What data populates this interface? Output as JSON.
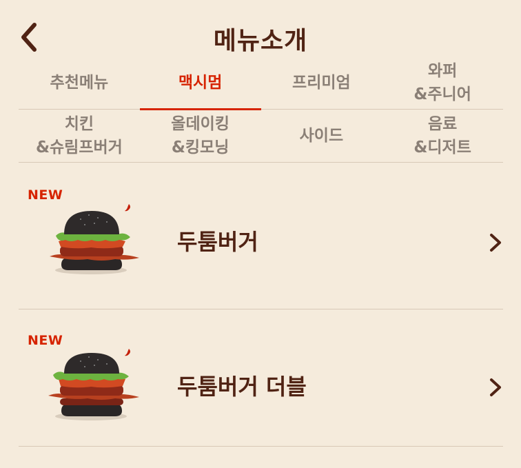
{
  "header": {
    "title": "메뉴소개"
  },
  "tabs": {
    "row1": [
      {
        "label": "추천메뉴",
        "active": false
      },
      {
        "label": "맥시멈",
        "active": true
      },
      {
        "label": "프리미엄",
        "active": false
      },
      {
        "label": "와퍼\n&주니어",
        "active": false
      }
    ],
    "row2": [
      {
        "label": "치킨\n&슈림프버거",
        "active": false
      },
      {
        "label": "올데이킹\n&킹모닝",
        "active": false
      },
      {
        "label": "사이드",
        "active": false
      },
      {
        "label": "음료\n&디저트",
        "active": false
      }
    ]
  },
  "menu": {
    "items": [
      {
        "badge": "NEW",
        "name": "두툼버거"
      },
      {
        "badge": "NEW",
        "name": "두툼버거 더블"
      }
    ]
  },
  "colors": {
    "background": "#f5ebdc",
    "brand_brown": "#502314",
    "accent_red": "#d62300",
    "inactive_gray": "#8a7f76",
    "divider": "#d8c8b6"
  },
  "icons": {
    "back": "chevron-left-icon",
    "item_arrow": "chevron-right-icon",
    "spicy": "chili-pepper-icon"
  }
}
